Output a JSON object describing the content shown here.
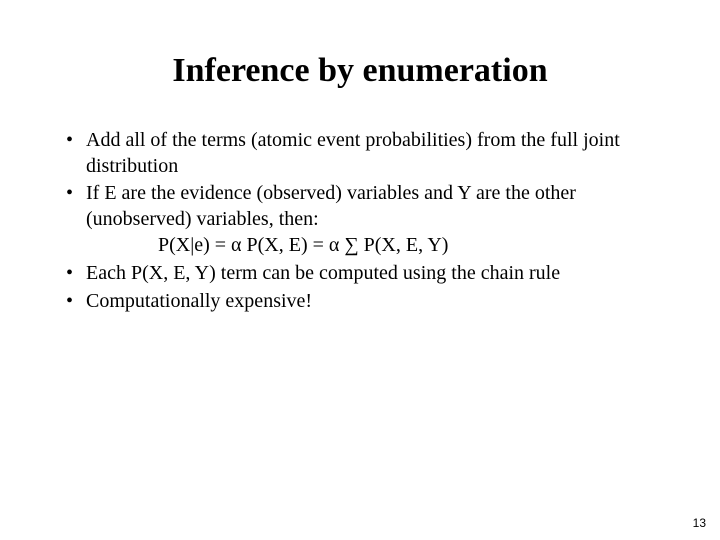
{
  "title": "Inference by enumeration",
  "bullets": {
    "b1": "Add all of the terms (atomic event probabilities) from the full joint distribution",
    "b2": "If E are the evidence (observed) variables and Y are the other (unobserved) variables, then:",
    "formula": "P(X|e) = α P(X, E) = α ∑ P(X, E, Y)",
    "b3": "Each P(X, E, Y) term can be computed using the chain rule",
    "b4": "Computationally expensive!"
  },
  "page_number": "13"
}
